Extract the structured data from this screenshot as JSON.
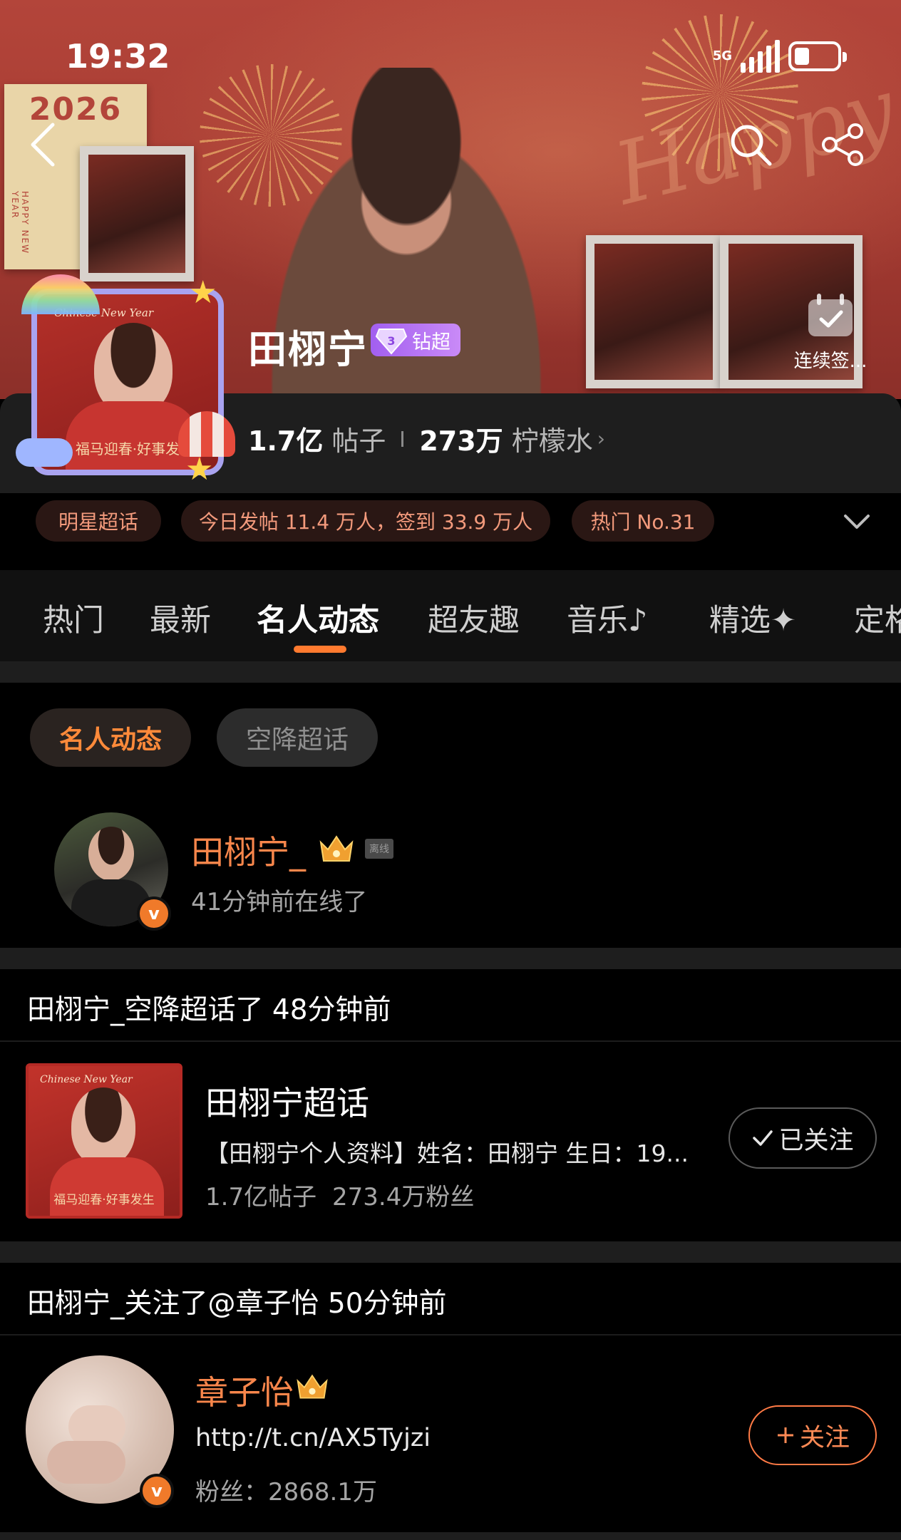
{
  "status_bar": {
    "time": "19:32",
    "network": "5G"
  },
  "header": {
    "back_icon": "chevron-left-icon",
    "search_icon": "search-icon",
    "share_icon": "share-icon",
    "checkin_label": "连续签...",
    "banner_year": "2026",
    "banner_vertical_text": "HAPPY NEW YEAR",
    "banner_script": "Happy",
    "avatar_caption_top": "Chinese New Year",
    "avatar_blessing": "福马迎春·好事发",
    "title": "田栩宁",
    "badge_level": "3",
    "badge_label": "钻超"
  },
  "stats": {
    "posts_value": "1.7亿",
    "posts_unit": "帖子",
    "lemon_value": "273万",
    "lemon_unit": "柠檬水"
  },
  "tags": [
    "明星超话",
    "今日发帖 11.4 万人，签到 33.9 万人",
    "热门 No.31"
  ],
  "tabs": [
    "热门",
    "最新",
    "名人动态",
    "超友趣",
    "音乐",
    "精选",
    "定格"
  ],
  "active_tab": "名人动态",
  "filters": {
    "active": "名人动态",
    "inactive": "空降超话"
  },
  "online_user": {
    "name": "田栩宁_",
    "offline_tag": "离线",
    "status": "41分钟前在线了"
  },
  "feed1": {
    "header": "田栩宁_空降超话了 48分钟前",
    "title": "田栩宁超话",
    "desc": "【田栩宁个人资料】姓名：田栩宁 生日：19...",
    "posts": "1.7亿帖子",
    "fans": "273.4万粉丝",
    "cover_caption": "Chinese New Year",
    "cover_blessing": "福马迎春·好事发生",
    "button": "已关注"
  },
  "feed2": {
    "header": "田栩宁_关注了@章子怡 50分钟前",
    "name": "章子怡",
    "link": "http://t.cn/AX5Tyjzi",
    "fans": "粉丝：2868.1万",
    "button": "关注"
  },
  "colors": {
    "accent": "#ff7a2f",
    "name_orange": "#f8864b",
    "badge_purple": "#a25ff0"
  }
}
